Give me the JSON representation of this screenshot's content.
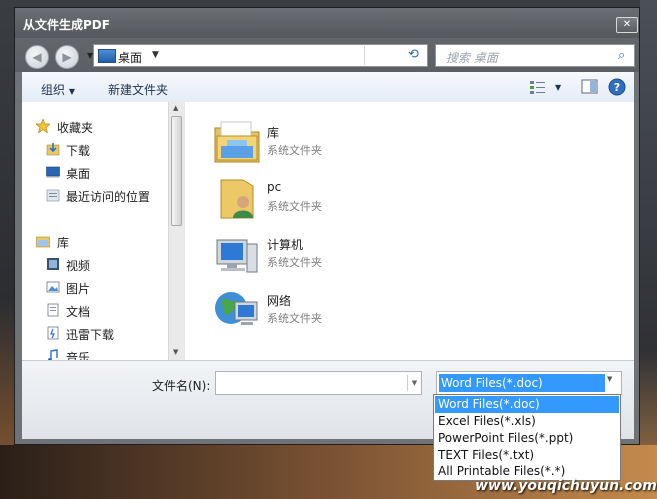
{
  "window": {
    "title": "从文件生成PDF",
    "close_glyph": "✕"
  },
  "address": {
    "location": "桌面",
    "search_placeholder": "搜索 桌面"
  },
  "toolbar": {
    "organize_label": "组织",
    "new_folder_label": "新建文件夹"
  },
  "nav": {
    "favorites": {
      "label": "收藏夹",
      "items": [
        {
          "label": "下载",
          "icon": "download-folder-icon"
        },
        {
          "label": "桌面",
          "icon": "desktop-icon"
        },
        {
          "label": "最近访问的位置",
          "icon": "recent-places-icon"
        }
      ]
    },
    "libraries": {
      "label": "库",
      "items": [
        {
          "label": "视频",
          "icon": "video-icon"
        },
        {
          "label": "图片",
          "icon": "pictures-icon"
        },
        {
          "label": "文档",
          "icon": "documents-icon"
        },
        {
          "label": "迅雷下载",
          "icon": "thunder-download-icon"
        },
        {
          "label": "音乐",
          "icon": "music-icon"
        }
      ]
    }
  },
  "files": [
    {
      "name": "库",
      "type": "系统文件夹",
      "icon": "library-icon"
    },
    {
      "name": "pc",
      "type": "系统文件夹",
      "icon": "user-folder-icon"
    },
    {
      "name": "计算机",
      "type": "系统文件夹",
      "icon": "computer-icon"
    },
    {
      "name": "网络",
      "type": "系统文件夹",
      "icon": "network-icon"
    }
  ],
  "bottom": {
    "filename_label": "文件名(N):",
    "filename_value": "",
    "filetype_selected": "Word Files(*.doc)"
  },
  "filetype_options": [
    "Word Files(*.doc)",
    "Excel Files(*.xls)",
    "PowerPoint Files(*.ppt)",
    "TEXT Files(*.txt)",
    "All Printable Files(*.*)"
  ],
  "watermark": "www.youqichuyun.com",
  "colors": {
    "selection": "#3399ff",
    "toolbar_text": "#1e3352"
  }
}
